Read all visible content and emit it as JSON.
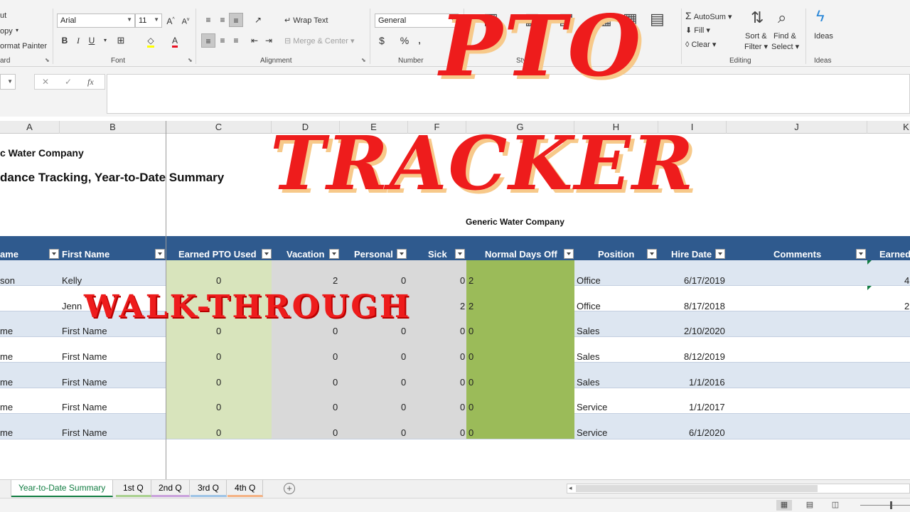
{
  "ribbon": {
    "clipboard": {
      "cut": "ut",
      "copy": "opy",
      "format_painter": "ormat Painter",
      "group": "ard"
    },
    "font": {
      "family": "Arial",
      "size": "11",
      "group": "Font"
    },
    "alignment": {
      "wrap_text": "Wrap Text",
      "merge_center": "Merge & Center",
      "group": "Alignment"
    },
    "number": {
      "format": "General",
      "group": "Number"
    },
    "styles": {
      "group": "Styles"
    },
    "editing": {
      "autosum": "AutoSum",
      "fill": "Fill",
      "clear": "Clear",
      "sort_filter": "Sort &",
      "sort_filter_2": "Filter",
      "find_select": "Find &",
      "find_select_2": "Select",
      "group": "Editing"
    },
    "ideas": {
      "label": "Ideas",
      "group": "Ideas"
    }
  },
  "formula_bar": {
    "fx": "fx",
    "value": ""
  },
  "columns": [
    "A",
    "B",
    "C",
    "D",
    "E",
    "F",
    "G",
    "H",
    "I",
    "J",
    "K"
  ],
  "sheet": {
    "company_partial": "c Water Company",
    "subtitle_partial": "dance Tracking, Year-to-Date Summary",
    "company_center": "Generic Water Company"
  },
  "table": {
    "headers": [
      "ame",
      "First Name",
      "Earned PTO Used",
      "Vacation",
      "Personal",
      "Sick",
      "Normal Days Off",
      "Position",
      "Hire Date",
      "Comments",
      "Earned"
    ],
    "rows": [
      {
        "last": "son",
        "first": "Kelly",
        "pto": "0",
        "vacation": "2",
        "personal": "0",
        "sick": "0",
        "normal": "2",
        "position": "Office",
        "hire": "6/17/2019",
        "earned": "4"
      },
      {
        "last": "",
        "first": "Jenn",
        "pto": "0",
        "vacation": "",
        "personal": "",
        "sick": "2",
        "normal": "2",
        "position": "Office",
        "hire": "8/17/2018",
        "earned": "2"
      },
      {
        "last": "me",
        "first": "First Name",
        "pto": "0",
        "vacation": "0",
        "personal": "0",
        "sick": "0",
        "normal": "0",
        "position": "Sales",
        "hire": "2/10/2020",
        "earned": ""
      },
      {
        "last": "me",
        "first": "First Name",
        "pto": "0",
        "vacation": "0",
        "personal": "0",
        "sick": "0",
        "normal": "0",
        "position": "Sales",
        "hire": "8/12/2019",
        "earned": ""
      },
      {
        "last": "me",
        "first": "First Name",
        "pto": "0",
        "vacation": "0",
        "personal": "0",
        "sick": "0",
        "normal": "0",
        "position": "Sales",
        "hire": "1/1/2016",
        "earned": ""
      },
      {
        "last": "me",
        "first": "First Name",
        "pto": "0",
        "vacation": "0",
        "personal": "0",
        "sick": "0",
        "normal": "0",
        "position": "Service",
        "hire": "1/1/2017",
        "earned": ""
      },
      {
        "last": "me",
        "first": "First Name",
        "pto": "0",
        "vacation": "0",
        "personal": "0",
        "sick": "0",
        "normal": "0",
        "position": "Service",
        "hire": "6/1/2020",
        "earned": ""
      }
    ]
  },
  "tabs": [
    {
      "label": "Year-to-Date Summary",
      "active": true
    },
    {
      "label": "1st Q",
      "color": "#a9d08e"
    },
    {
      "label": "2nd Q",
      "color": "#c9a0dc"
    },
    {
      "label": "3rd Q",
      "color": "#9dc3e6"
    },
    {
      "label": "4th Q",
      "color": "#f4b183"
    }
  ],
  "overlay": {
    "line1": "PTO",
    "line2": "TRACKER",
    "line3": "WALK-THROUGH"
  },
  "colors": {
    "header_blue": "#2f5a8e",
    "band": "#dde6f1",
    "green_col": "#d8e4bc",
    "gray_cols": "#d9d9d9",
    "olive_col": "#9bbb59",
    "overlay_red": "#ee1c1c",
    "excel_green": "#107c41"
  }
}
